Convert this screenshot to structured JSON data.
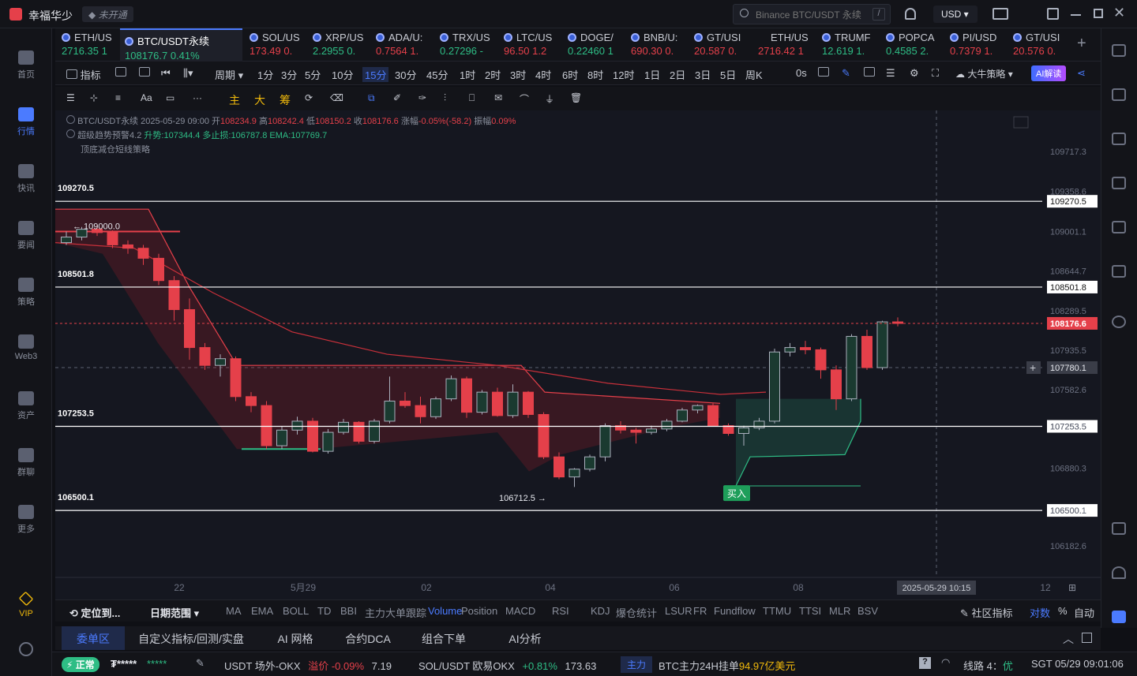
{
  "app": {
    "name": "幸福华少",
    "badge": "未开通"
  },
  "titlebar": {
    "search_placeholder": "Binance BTC/USDT 永续",
    "search_hint": "/",
    "currency": "USD"
  },
  "leftnav": [
    {
      "label": "首页",
      "icon": "home-icon"
    },
    {
      "label": "行情",
      "icon": "market-icon",
      "active": true
    },
    {
      "label": "快讯",
      "icon": "news-icon"
    },
    {
      "label": "要闻",
      "icon": "headline-icon"
    },
    {
      "label": "策略",
      "icon": "strategy-icon"
    },
    {
      "label": "Web3",
      "icon": "web3-icon"
    },
    {
      "label": "资产",
      "icon": "wallet-icon"
    },
    {
      "label": "群聊",
      "icon": "chat-icon"
    },
    {
      "label": "更多",
      "icon": "more-icon"
    },
    {
      "label": "VIP",
      "icon": "vip-icon"
    }
  ],
  "tabs": [
    {
      "name": "ETH/US",
      "price": "2716.35 1",
      "color": "green"
    },
    {
      "name": "BTC/USDT永续",
      "price": "108176.7 0.41%",
      "color": "green",
      "active": true
    },
    {
      "name": "SOL/US",
      "price": "173.49 0.",
      "color": "red"
    },
    {
      "name": "XRP/US",
      "price": "2.2955 0.",
      "color": "green"
    },
    {
      "name": "ADA/U:",
      "price": "0.7564 1.",
      "color": "red"
    },
    {
      "name": "TRX/US",
      "price": "0.27296 -",
      "color": "green"
    },
    {
      "name": "LTC/US",
      "price": "96.50 1.2",
      "color": "red"
    },
    {
      "name": "DOGE/",
      "price": "0.22460 1",
      "color": "green"
    },
    {
      "name": "BNB/U:",
      "price": "690.30 0.",
      "color": "red"
    },
    {
      "name": "GT/USI",
      "price": "20.587 0.",
      "color": "red"
    },
    {
      "name": "ETH/US",
      "price": "2716.42 1",
      "color": "red"
    },
    {
      "name": "TRUMF",
      "price": "12.619 1.",
      "color": "green"
    },
    {
      "name": "POPCA",
      "price": "0.4585 2.",
      "color": "green"
    },
    {
      "name": "PI/USD",
      "price": "0.7379 1.",
      "color": "red"
    },
    {
      "name": "GT/USI",
      "price": "20.576 0.",
      "color": "red"
    }
  ],
  "periodbar": {
    "indicator": "指标",
    "cycle": "周期",
    "periods": [
      "1分",
      "3分",
      "5分",
      "10分",
      "15分",
      "30分",
      "45分",
      "1时",
      "2时",
      "3时",
      "4时",
      "6时",
      "8时",
      "12时",
      "1日",
      "2日",
      "3日",
      "5日",
      "周K"
    ],
    "active_period": "15分",
    "countdown": "0s",
    "strategy": "大牛策略",
    "ai": "AI解读"
  },
  "drawbar": {
    "labels": [
      "主",
      "大",
      "筹"
    ]
  },
  "chart_info": {
    "line1": "BTC/USDT永续 2025-05-29 09:00",
    "open_label": "开",
    "open": "108234.9",
    "high_label": "高",
    "high": "108242.4",
    "low_label": "低",
    "low": "108150.2",
    "close_label": "收",
    "close": "108176.6",
    "change_label": "涨幅",
    "change": "-0.05%(-58.2)",
    "amp_label": "振幅",
    "amp": "0.09%",
    "line2_name": "超级趋势预警4.2",
    "line2_trend": "升势:107344.4",
    "line2_stop": "多止损:106787.8",
    "line2_ema": "EMA:107769.7",
    "line3": "顶底减仓短线策略"
  },
  "chart_data": {
    "type": "candlestick",
    "y_ticks": [
      109717.3,
      109358.6,
      109001.1,
      108644.7,
      108289.5,
      107935.5,
      107582.6,
      107253.5,
      106880.3,
      106500.1,
      106182.6
    ],
    "x_ticks": [
      "22",
      "5月29",
      "02",
      "04",
      "06",
      "08",
      "12"
    ],
    "ylim": [
      106000,
      109950
    ],
    "horizontal_levels": [
      {
        "value": 109270.5,
        "label": "109270.5"
      },
      {
        "value": 108501.8,
        "label": "108501.8"
      },
      {
        "value": 107253.5,
        "label": "107253.5"
      },
      {
        "value": 106500.1,
        "label": "106500.1"
      }
    ],
    "last_price": "108176.6",
    "crosshair_price": "107780.1",
    "crosshair_time": "2025-05-29 10:15",
    "annotations": [
      {
        "text": "109000.0",
        "value": 109000.0
      },
      {
        "text": "106712.5",
        "value": 106712.5
      },
      {
        "text": "买入"
      }
    ],
    "candles": [
      [
        108900,
        109000,
        108880,
        108950
      ],
      [
        108950,
        109040,
        108920,
        109020
      ],
      [
        109020,
        109060,
        108960,
        108990
      ],
      [
        108990,
        109010,
        108850,
        108880
      ],
      [
        108880,
        108920,
        108800,
        108850
      ],
      [
        108850,
        108880,
        108700,
        108760
      ],
      [
        108760,
        108800,
        108520,
        108560
      ],
      [
        108560,
        108600,
        108200,
        108300
      ],
      [
        108300,
        108400,
        107850,
        107960
      ],
      [
        107960,
        108000,
        107760,
        107800
      ],
      [
        107800,
        107900,
        107700,
        107860
      ],
      [
        107860,
        107880,
        107480,
        107520
      ],
      [
        107520,
        107560,
        107380,
        107440
      ],
      [
        107440,
        107480,
        107050,
        107080
      ],
      [
        107080,
        107250,
        107050,
        107220
      ],
      [
        107220,
        107340,
        107180,
        107300
      ],
      [
        107300,
        107330,
        107020,
        107030
      ],
      [
        107030,
        107230,
        107010,
        107200
      ],
      [
        107200,
        107320,
        107180,
        107290
      ],
      [
        107290,
        107300,
        107100,
        107120
      ],
      [
        107120,
        107320,
        107100,
        107300
      ],
      [
        107300,
        107700,
        107280,
        107480
      ],
      [
        107480,
        107560,
        107420,
        107440
      ],
      [
        107440,
        107520,
        107280,
        107340
      ],
      [
        107340,
        107520,
        107320,
        107500
      ],
      [
        107500,
        107710,
        107480,
        107680
      ],
      [
        107680,
        107700,
        107330,
        107380
      ],
      [
        107380,
        107580,
        107360,
        107560
      ],
      [
        107560,
        107600,
        107340,
        107350
      ],
      [
        107350,
        107630,
        107330,
        107560
      ],
      [
        107560,
        107570,
        107330,
        107360
      ],
      [
        107360,
        107380,
        106960,
        106980
      ],
      [
        106980,
        107020,
        106780,
        106800
      ],
      [
        106800,
        106880,
        106710,
        106870
      ],
      [
        106870,
        107000,
        106850,
        106980
      ],
      [
        106980,
        107280,
        106940,
        107260
      ],
      [
        107260,
        107300,
        107190,
        107220
      ],
      [
        107220,
        107240,
        107100,
        107200
      ],
      [
        107200,
        107260,
        107180,
        107230
      ],
      [
        107230,
        107320,
        107210,
        107300
      ],
      [
        107300,
        107420,
        107290,
        107400
      ],
      [
        107400,
        107450,
        107370,
        107440
      ],
      [
        107440,
        107460,
        107250,
        107260
      ],
      [
        107260,
        107280,
        107170,
        107190
      ],
      [
        107190,
        107260,
        107080,
        107240
      ],
      [
        107240,
        107330,
        107220,
        107300
      ],
      [
        107300,
        107950,
        107280,
        107920
      ],
      [
        107920,
        108000,
        107880,
        107960
      ],
      [
        107960,
        108020,
        107900,
        107940
      ],
      [
        107940,
        107960,
        107680,
        107760
      ],
      [
        107760,
        107800,
        107400,
        107500
      ],
      [
        107500,
        108080,
        107480,
        108060
      ],
      [
        108060,
        108120,
        107760,
        107780
      ],
      [
        107780,
        108200,
        107760,
        108190
      ],
      [
        108190,
        108230,
        108150,
        108176
      ]
    ]
  },
  "indbar": {
    "locate": "定位到...",
    "range": "日期范围",
    "items": [
      "MA",
      "EMA",
      "BOLL",
      "TD",
      "BBI",
      "主力大单跟踪",
      "Volume",
      "Position",
      "MACD",
      "RSI",
      "KDJ",
      "爆仓统计",
      "LSUR",
      "FR",
      "Fundflow",
      "TTMU",
      "TTSI",
      "MLR",
      "BSV"
    ],
    "active": "Volume",
    "community": "社区指标",
    "log": "对数",
    "pct": "%",
    "auto": "自动"
  },
  "orderbar": {
    "tabs": [
      "委单区",
      "自定义指标/回测/实盘",
      "AI 网格",
      "合约DCA",
      "组合下单",
      "AI分析"
    ],
    "active": "委单区"
  },
  "statusbar": {
    "status": "正常",
    "user": "₮*****",
    "stars": "*****",
    "pair1": "USDT 场外-OKX",
    "prem_label": "溢价",
    "prem": "-0.09%",
    "prem_val": "7.19",
    "pair2": "SOL/USDT 欧易OKX",
    "pair2_chg": "+0.81%",
    "pair2_px": "173.63",
    "main_label": "主力",
    "main_text": "BTC主力24H挂单",
    "main_val": "94.97亿美元",
    "line": "线路 4：",
    "line_q": "优",
    "time": "SGT 05/29 09:01:06"
  },
  "colors": {
    "up": "#2ebd85",
    "down": "#e5404a",
    "accent": "#4b7bff"
  }
}
